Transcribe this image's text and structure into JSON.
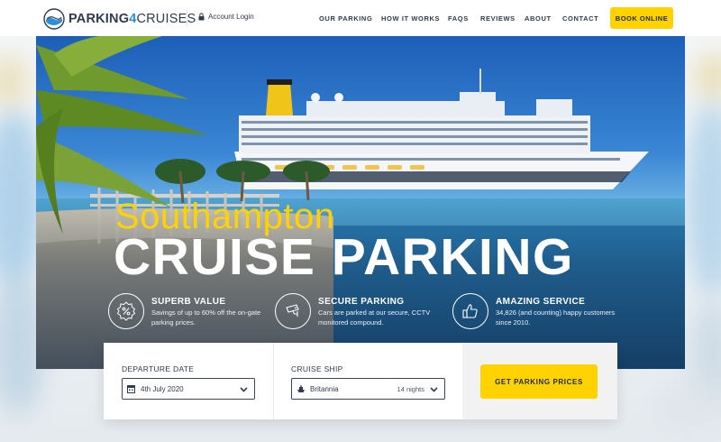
{
  "brand": {
    "name_part1": "PARKING",
    "name_number": "4",
    "name_part2": "CRUISES"
  },
  "header": {
    "account_login": "Account Login",
    "nav": [
      "OUR PARKING",
      "HOW IT WORKS",
      "FAQS",
      "REVIEWS",
      "ABOUT",
      "CONTACT"
    ],
    "book_online": "BOOK ONLINE"
  },
  "hero": {
    "subtitle": "Southampton",
    "title": "CRUISE PARKING",
    "features": [
      {
        "icon": "percent-badge-icon",
        "title": "SUPERB VALUE",
        "desc": "Savings of up to 60% off the on-gate parking prices."
      },
      {
        "icon": "cctv-camera-icon",
        "title": "SECURE PARKING",
        "desc": "Cars are parked at our secure, CCTV monitored compound."
      },
      {
        "icon": "thumbs-up-icon",
        "title": "AMAZING SERVICE",
        "desc": "34,826 (and counting) happy customers since 2010."
      }
    ]
  },
  "booking": {
    "departure_label": "DEPARTURE DATE",
    "departure_value": "4th July 2020",
    "ship_label": "CRUISE SHIP",
    "ship_value": "Britannia",
    "ship_nights": "14 nights",
    "cta": "GET PARKING PRICES"
  },
  "colors": {
    "accent_yellow": "#ffd200",
    "text_dark": "#2f3b4f",
    "brand_blue": "#2f8fd6"
  }
}
